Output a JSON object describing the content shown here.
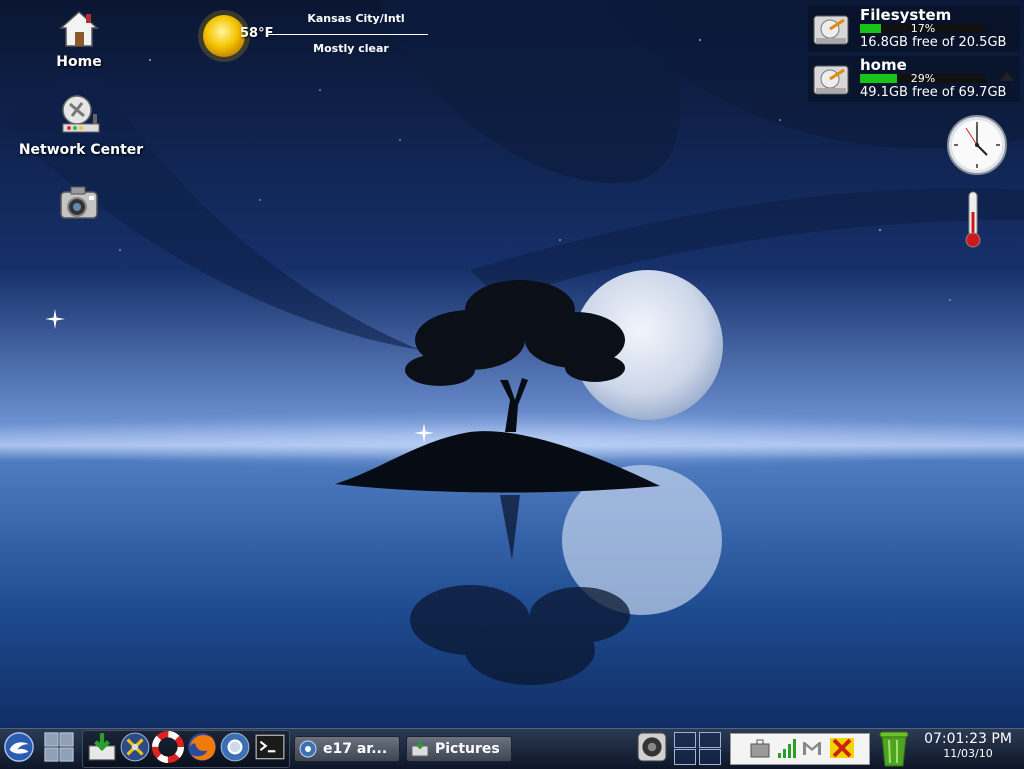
{
  "desktop": {
    "icons": [
      {
        "name": "home-icon",
        "label": "Home"
      },
      {
        "name": "network-center-icon",
        "label": "Network Center"
      },
      {
        "name": "camera-icon",
        "label": ""
      }
    ]
  },
  "weather": {
    "temperature": "58°F",
    "location": "Kansas City/Intl",
    "condition": "Mostly clear",
    "icon": "sun-icon"
  },
  "filesystems": [
    {
      "name": "Filesystem",
      "percent_used": 17,
      "percent_label": "17%",
      "free_text": "16.8GB free of 20.5GB"
    },
    {
      "name": "home",
      "percent_used": 29,
      "percent_label": "29%",
      "free_text": "49.1GB free of 69.7GB"
    }
  ],
  "gadgets": {
    "clock_icon": "analog-clock-icon",
    "thermometer_icon": "thermometer-icon"
  },
  "shelf": {
    "launchers": [
      {
        "name": "start-menu-icon"
      },
      {
        "name": "desktop-grid-icon"
      },
      {
        "name": "software-install-icon"
      },
      {
        "name": "settings-tools-icon"
      },
      {
        "name": "lifesaver-help-icon"
      },
      {
        "name": "firefox-icon"
      },
      {
        "name": "chromium-icon"
      },
      {
        "name": "terminal-icon"
      }
    ],
    "tasks": [
      {
        "label": "e17 ar...",
        "icon": "browser-icon"
      },
      {
        "label": "Pictures",
        "icon": "folder-icon"
      }
    ],
    "tray": [
      "mixer-icon",
      "briefcase-icon",
      "signal-icon",
      "mail-icon",
      "x-status-icon"
    ],
    "time": "07:01:23 PM",
    "date": "11/03/10"
  },
  "colors": {
    "bar_fill": "#19c419",
    "sky_dark": "#0b1a3a",
    "water": "#1e4d8c"
  }
}
